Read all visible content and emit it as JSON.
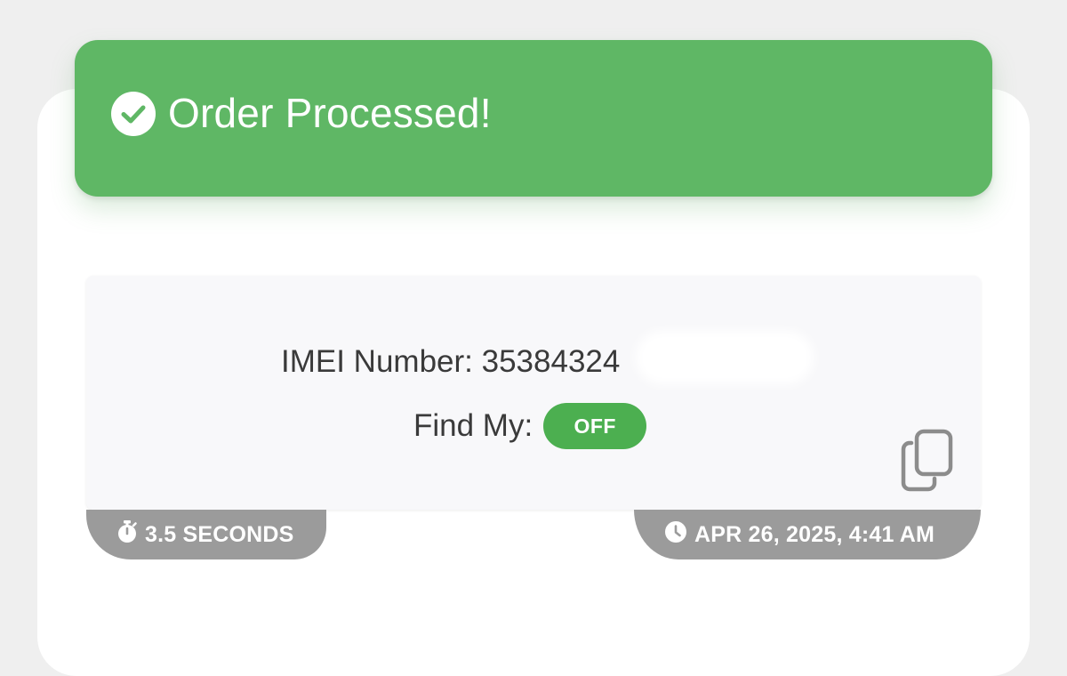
{
  "banner": {
    "title": "Order Processed!",
    "icon": "check-circle-icon",
    "color": "#5fb765"
  },
  "result": {
    "imei_label": "IMEI Number:",
    "imei_value": "35384324",
    "find_my_label": "Find My:",
    "find_my_status": "OFF",
    "status_color": "#4caf50",
    "copy_icon": "copy-icon"
  },
  "footer": {
    "duration": "3.5 SECONDS",
    "duration_icon": "stopwatch-icon",
    "timestamp": "APR 26, 2025, 4:41 AM",
    "timestamp_icon": "clock-icon",
    "tag_color": "#9b9b9b"
  }
}
